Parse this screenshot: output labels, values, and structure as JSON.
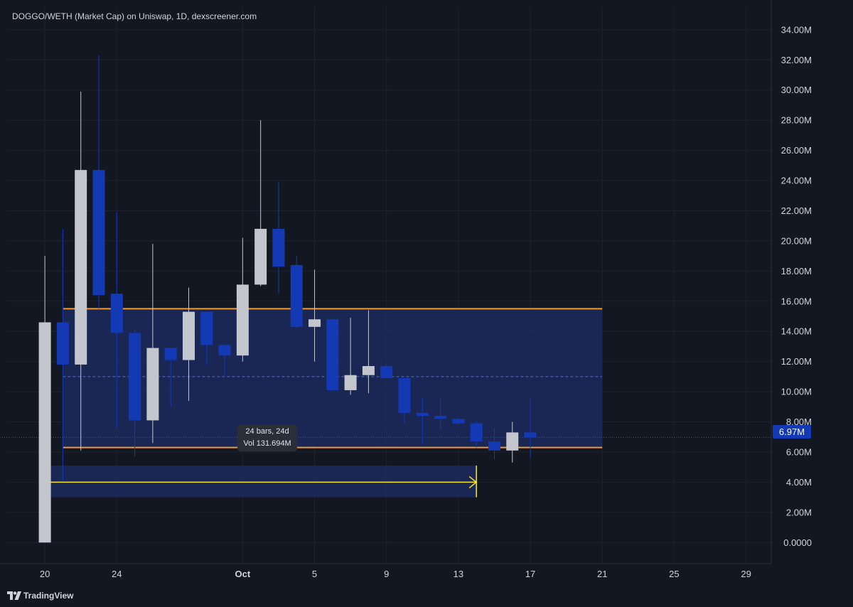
{
  "header": {
    "title": "DOGGO/WETH (Market Cap) on Uniswap, 1D, dexscreener.com"
  },
  "last_price_label": "6.97M",
  "measure": {
    "line1": "24 bars, 24d",
    "line2": "Vol 131.694M"
  },
  "brand": {
    "name": "TradingView"
  },
  "colors": {
    "background": "#131722",
    "grid": "#1e2230",
    "up_candle": "#c4c6ce",
    "down_candle": "#1439b5",
    "range_box": "#1c2a5e",
    "range_border": "#f39a2c",
    "measure_line": "#f5e829",
    "price_tag": "#1439b5"
  },
  "chart_data": {
    "type": "candlestick",
    "title": "DOGGO/WETH (Market Cap) on Uniswap, 1D, dexscreener.com",
    "y_axis": {
      "ticks": [
        "0.0000",
        "2.00M",
        "4.00M",
        "6.00M",
        "8.00M",
        "10.00M",
        "12.00M",
        "14.00M",
        "16.00M",
        "18.00M",
        "20.00M",
        "22.00M",
        "24.00M",
        "26.00M",
        "28.00M",
        "30.00M",
        "32.00M",
        "34.00M"
      ],
      "tick_values": [
        0,
        2,
        4,
        6,
        8,
        10,
        12,
        14,
        16,
        18,
        20,
        22,
        24,
        26,
        28,
        30,
        32,
        34
      ],
      "unit": "M",
      "ylim": [
        -1.4,
        35.5
      ]
    },
    "x_axis": {
      "ticks": [
        {
          "label": "20",
          "day": 0
        },
        {
          "label": "24",
          "day": 4
        },
        {
          "label": "Oct",
          "day": 11
        },
        {
          "label": "5",
          "day": 15
        },
        {
          "label": "9",
          "day": 19
        },
        {
          "label": "13",
          "day": 23
        },
        {
          "label": "17",
          "day": 27
        },
        {
          "label": "21",
          "day": 31
        },
        {
          "label": "25",
          "day": 35
        },
        {
          "label": "29",
          "day": 39
        }
      ],
      "xlim": [
        -2.1,
        40.4
      ]
    },
    "candles": [
      {
        "day": 0,
        "o": 0.0,
        "h": 19.0,
        "l": 0.0,
        "c": 14.6
      },
      {
        "day": 1,
        "o": 14.6,
        "h": 20.8,
        "l": 4.1,
        "c": 11.8
      },
      {
        "day": 2,
        "o": 11.8,
        "h": 29.9,
        "l": 6.1,
        "c": 24.7
      },
      {
        "day": 3,
        "o": 24.7,
        "h": 32.3,
        "l": 15.5,
        "c": 16.4
      },
      {
        "day": 4,
        "o": 16.5,
        "h": 21.9,
        "l": 7.6,
        "c": 13.9
      },
      {
        "day": 5,
        "o": 13.9,
        "h": 14.1,
        "l": 5.7,
        "c": 8.1
      },
      {
        "day": 6,
        "o": 8.1,
        "h": 19.8,
        "l": 6.6,
        "c": 12.9
      },
      {
        "day": 7,
        "o": 12.9,
        "h": 12.9,
        "l": 9.0,
        "c": 12.1
      },
      {
        "day": 8,
        "o": 12.1,
        "h": 16.9,
        "l": 9.4,
        "c": 15.3
      },
      {
        "day": 9,
        "o": 15.3,
        "h": 15.3,
        "l": 11.8,
        "c": 13.1
      },
      {
        "day": 10,
        "o": 13.1,
        "h": 13.1,
        "l": 11.0,
        "c": 12.4
      },
      {
        "day": 11,
        "o": 12.4,
        "h": 20.2,
        "l": 12.0,
        "c": 17.1
      },
      {
        "day": 12,
        "o": 17.1,
        "h": 28.0,
        "l": 17.0,
        "c": 20.8
      },
      {
        "day": 13,
        "o": 20.8,
        "h": 23.9,
        "l": 16.5,
        "c": 18.3
      },
      {
        "day": 14,
        "o": 18.4,
        "h": 19.0,
        "l": 14.2,
        "c": 14.3
      },
      {
        "day": 15,
        "o": 14.3,
        "h": 18.1,
        "l": 12.0,
        "c": 14.8
      },
      {
        "day": 16,
        "o": 14.8,
        "h": 14.9,
        "l": 10.1,
        "c": 10.1
      },
      {
        "day": 17,
        "o": 10.1,
        "h": 14.9,
        "l": 9.8,
        "c": 11.1
      },
      {
        "day": 18,
        "o": 11.1,
        "h": 15.4,
        "l": 9.9,
        "c": 11.7
      },
      {
        "day": 19,
        "o": 11.7,
        "h": 11.9,
        "l": 10.9,
        "c": 10.9
      },
      {
        "day": 20,
        "o": 10.9,
        "h": 10.9,
        "l": 7.9,
        "c": 8.6
      },
      {
        "day": 21,
        "o": 8.6,
        "h": 9.6,
        "l": 6.5,
        "c": 8.4
      },
      {
        "day": 22,
        "o": 8.4,
        "h": 9.6,
        "l": 7.5,
        "c": 8.2
      },
      {
        "day": 23,
        "o": 8.2,
        "h": 8.3,
        "l": 7.8,
        "c": 7.9
      },
      {
        "day": 24,
        "o": 7.9,
        "h": 8.1,
        "l": 6.3,
        "c": 6.7
      },
      {
        "day": 25,
        "o": 6.7,
        "h": 7.6,
        "l": 5.5,
        "c": 6.1
      },
      {
        "day": 26,
        "o": 6.1,
        "h": 8.0,
        "l": 5.3,
        "c": 7.3
      },
      {
        "day": 27,
        "o": 7.3,
        "h": 9.5,
        "l": 5.6,
        "c": 6.97
      }
    ],
    "range_box": {
      "x0": 1.0,
      "x1": 31.0,
      "top": 15.5,
      "bottom": 6.3,
      "mid": 11.0
    },
    "measure": {
      "x0": 0.3,
      "x1": 24.0,
      "top": 5.1,
      "bottom": 3.0,
      "y": 4.0
    },
    "last_price": 6.97
  }
}
